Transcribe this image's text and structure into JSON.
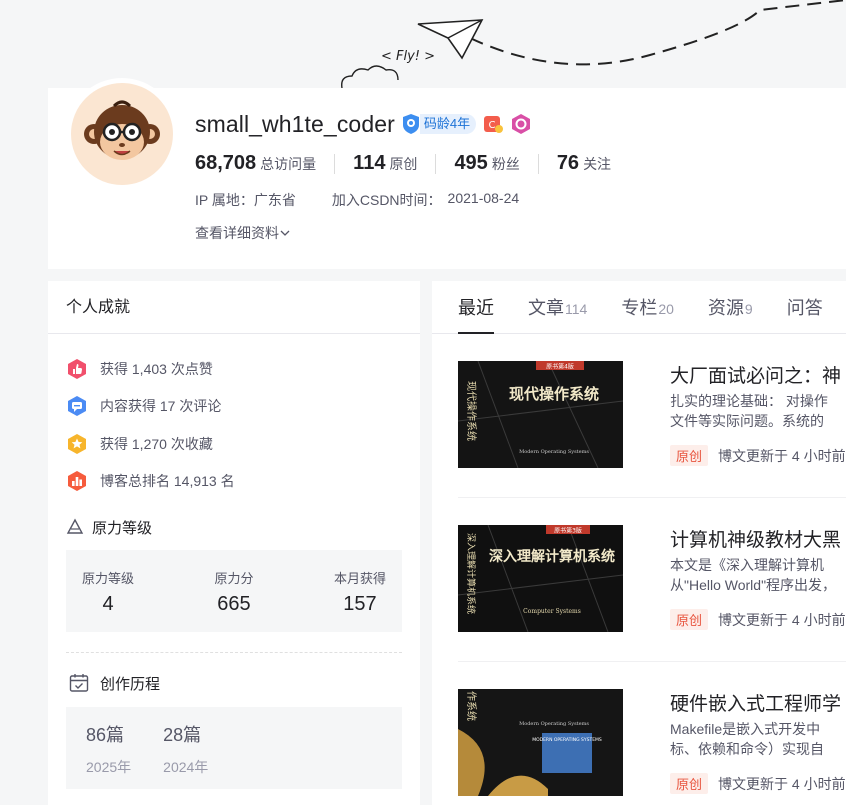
{
  "banner": {
    "fly_text": "< Fly! >"
  },
  "profile": {
    "username": "small_wh1te_coder",
    "code_age": "码龄4年",
    "stats": [
      {
        "num": "68,708",
        "label": "总访问量"
      },
      {
        "num": "114",
        "label": "原创"
      },
      {
        "num": "495",
        "label": "粉丝"
      },
      {
        "num": "76",
        "label": "关注"
      }
    ],
    "ip_location": "IP 属地：广东省",
    "join_label": "加入CSDN时间：",
    "join_date": "2021-08-24",
    "detail_link": "查看详细资料"
  },
  "achievements": {
    "title": "个人成就",
    "items": [
      {
        "text": "获得 1,403 次点赞",
        "icon": "thumb-up-icon",
        "color": "#f1506c"
      },
      {
        "text": "内容获得 17 次评论",
        "icon": "comment-icon",
        "color": "#4b8bf4"
      },
      {
        "text": "获得 1,270 次收藏",
        "icon": "star-icon",
        "color": "#f7b52c"
      },
      {
        "text": "博客总排名 14,913 名",
        "icon": "rank-icon",
        "color": "#f65c3d"
      }
    ]
  },
  "force": {
    "title": "原力等级",
    "cols": [
      {
        "label": "原力等级",
        "value": "4"
      },
      {
        "label": "原力分",
        "value": "665"
      },
      {
        "label": "本月获得",
        "value": "157"
      }
    ]
  },
  "history": {
    "title": "创作历程",
    "years": [
      {
        "value": "86篇",
        "year": "2025年"
      },
      {
        "value": "28篇",
        "year": "2024年"
      }
    ]
  },
  "tabs": [
    {
      "label": "最近",
      "count": ""
    },
    {
      "label": "文章",
      "count": "114"
    },
    {
      "label": "专栏",
      "count": "20"
    },
    {
      "label": "资源",
      "count": "9"
    },
    {
      "label": "问答",
      "count": ""
    }
  ],
  "articles": [
    {
      "title": "大厂面试必问之：神",
      "desc1": "扎实的理论基础： 对操作",
      "desc2": "文件等实际问题。系统的",
      "tag": "原创",
      "time": "博文更新于 4 小时前",
      "cover": {
        "ribbon": "原书第4版",
        "title": "现代操作系统",
        "side": "现代操作系统",
        "en": "Modern Operating Systems"
      }
    },
    {
      "title": "计算机神级教材大黑",
      "desc1": "本文是《深入理解计算机",
      "desc2": "从\"Hello World\"程序出发，",
      "tag": "原创",
      "time": "博文更新于 4 小时前",
      "cover": {
        "ribbon": "原书第3版",
        "title": "深入理解计算机系统",
        "side": "深入理解计算机系统",
        "en": "Computer Systems"
      }
    },
    {
      "title": "硬件嵌入式工程师学",
      "desc1": "Makefile是嵌入式开发中",
      "desc2": "标、依赖和命令）实现自",
      "tag": "原创",
      "time": "博文更新于 4 小时前",
      "cover": {
        "ribbon": "",
        "title": "MODERN OPERATING SYSTEMS",
        "side": "作系统",
        "en": "Modern Operating Systems"
      }
    }
  ]
}
